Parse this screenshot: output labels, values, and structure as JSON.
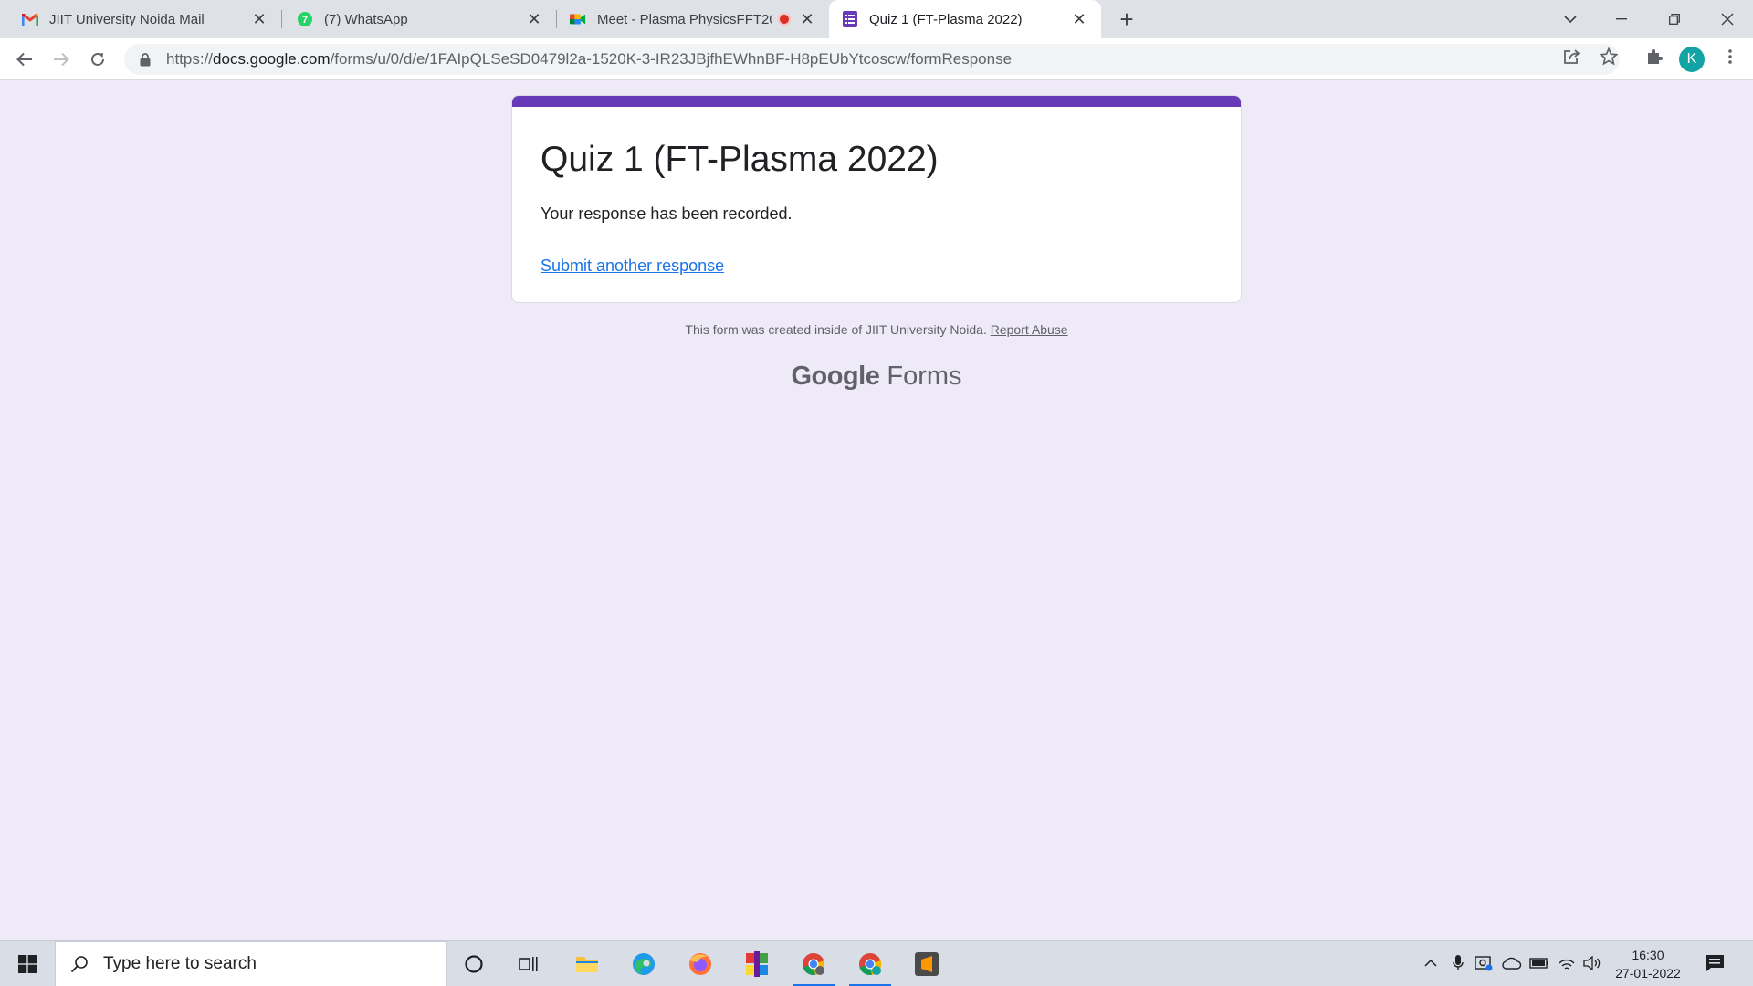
{
  "browser": {
    "tabs": [
      {
        "title": "JIIT University Noida Mail",
        "icon": "gmail-icon"
      },
      {
        "title": "(7) WhatsApp",
        "icon": "whatsapp-icon"
      },
      {
        "title": "Meet - Plasma PhysicsFFT20...",
        "icon": "google-meet-icon"
      },
      {
        "title": "Quiz 1 (FT-Plasma 2022)",
        "icon": "google-forms-icon"
      }
    ],
    "new_tab_label": "+",
    "url_prefix": "https://",
    "url_host": "docs.google.com",
    "url_path": "/forms/u/0/d/e/1FAIpQLSeSD0479l2a-1520K-3-IR23JBjfhEWhnBF-H8pEUbYtcoscw/formResponse",
    "profile_initial": "K",
    "accent_color": "#673ab7"
  },
  "form": {
    "title": "Quiz 1 (FT-Plasma 2022)",
    "confirmation": "Your response has been recorded.",
    "submit_another": "Submit another response",
    "footer_text": "This form was created inside of JIIT University Noida.",
    "report_abuse": "Report Abuse",
    "brand_google": "Google",
    "brand_forms": "Forms"
  },
  "taskbar": {
    "search_placeholder": "Type here to search",
    "time": "16:30",
    "date": "27-01-2022"
  }
}
